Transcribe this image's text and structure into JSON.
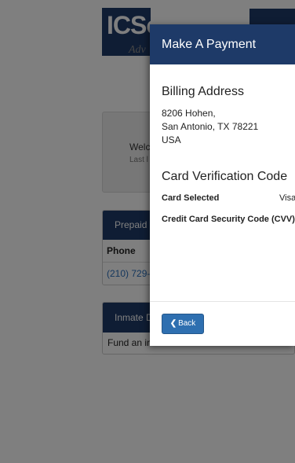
{
  "background": {
    "logo_text": "ICSolutions",
    "logo_subtext": "Adv",
    "welcome_title": "Welc",
    "welcome_sub": "Last l",
    "prepaid_panel": {
      "header": "Prepaid C",
      "column": "Phone",
      "phone": "(210) 729-"
    },
    "inmate_panel": {
      "header": "Inmate D",
      "text": "Fund an in"
    }
  },
  "modal": {
    "title": "Make A Payment",
    "billing": {
      "heading": "Billing Address",
      "line1": "8206 Hohen,",
      "line2": "San Antonio, TX 78221",
      "line3": "USA"
    },
    "cvv": {
      "heading": "Card Verification Code",
      "card_selected_label": "Card Selected",
      "card_selected_value": "Visa",
      "security_code_label": "Credit Card Security Code (CVV)"
    },
    "back_label": "Back",
    "back_icon": "chevron-left-icon"
  },
  "colors": {
    "header_blue": "#1e3a68",
    "button_blue": "#2e6fb0",
    "link_blue": "#2a6ebb"
  }
}
